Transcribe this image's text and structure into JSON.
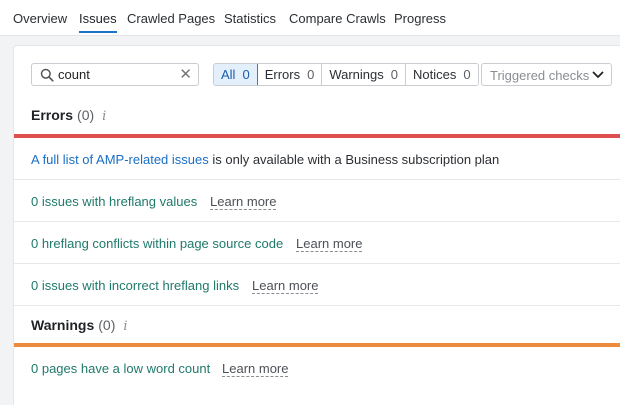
{
  "tabs": [
    {
      "label": "Overview"
    },
    {
      "label": "Issues",
      "active": true
    },
    {
      "label": "Crawled Pages"
    },
    {
      "label": "Statistics"
    },
    {
      "label": "Compare Crawls"
    },
    {
      "label": "Progress"
    }
  ],
  "search": {
    "value": "count",
    "clear_icon": "close-icon"
  },
  "filters": [
    {
      "label": "All",
      "count": "0",
      "active": true
    },
    {
      "label": "Errors",
      "count": "0"
    },
    {
      "label": "Warnings",
      "count": "0"
    },
    {
      "label": "Notices",
      "count": "0"
    }
  ],
  "checks_dropdown": {
    "placeholder": "Triggered checks"
  },
  "errors": {
    "title": "Errors",
    "count": "(0)",
    "info": "i",
    "color": "#e0504e",
    "notice_link": "A full list of AMP-related issues",
    "notice_rest": " is only available with a Business subscription plan",
    "rows": [
      {
        "text": "0 issues with hreflang values",
        "learn": "Learn more"
      },
      {
        "text": "0 hreflang conflicts within page source code",
        "learn": "Learn more"
      },
      {
        "text": "0 issues with incorrect hreflang links",
        "learn": "Learn more"
      }
    ]
  },
  "warnings": {
    "title": "Warnings",
    "count": "(0)",
    "info": "i",
    "color": "#ee8a3c",
    "rows": [
      {
        "text": "0 pages have a low word count",
        "learn": "Learn more"
      }
    ]
  }
}
